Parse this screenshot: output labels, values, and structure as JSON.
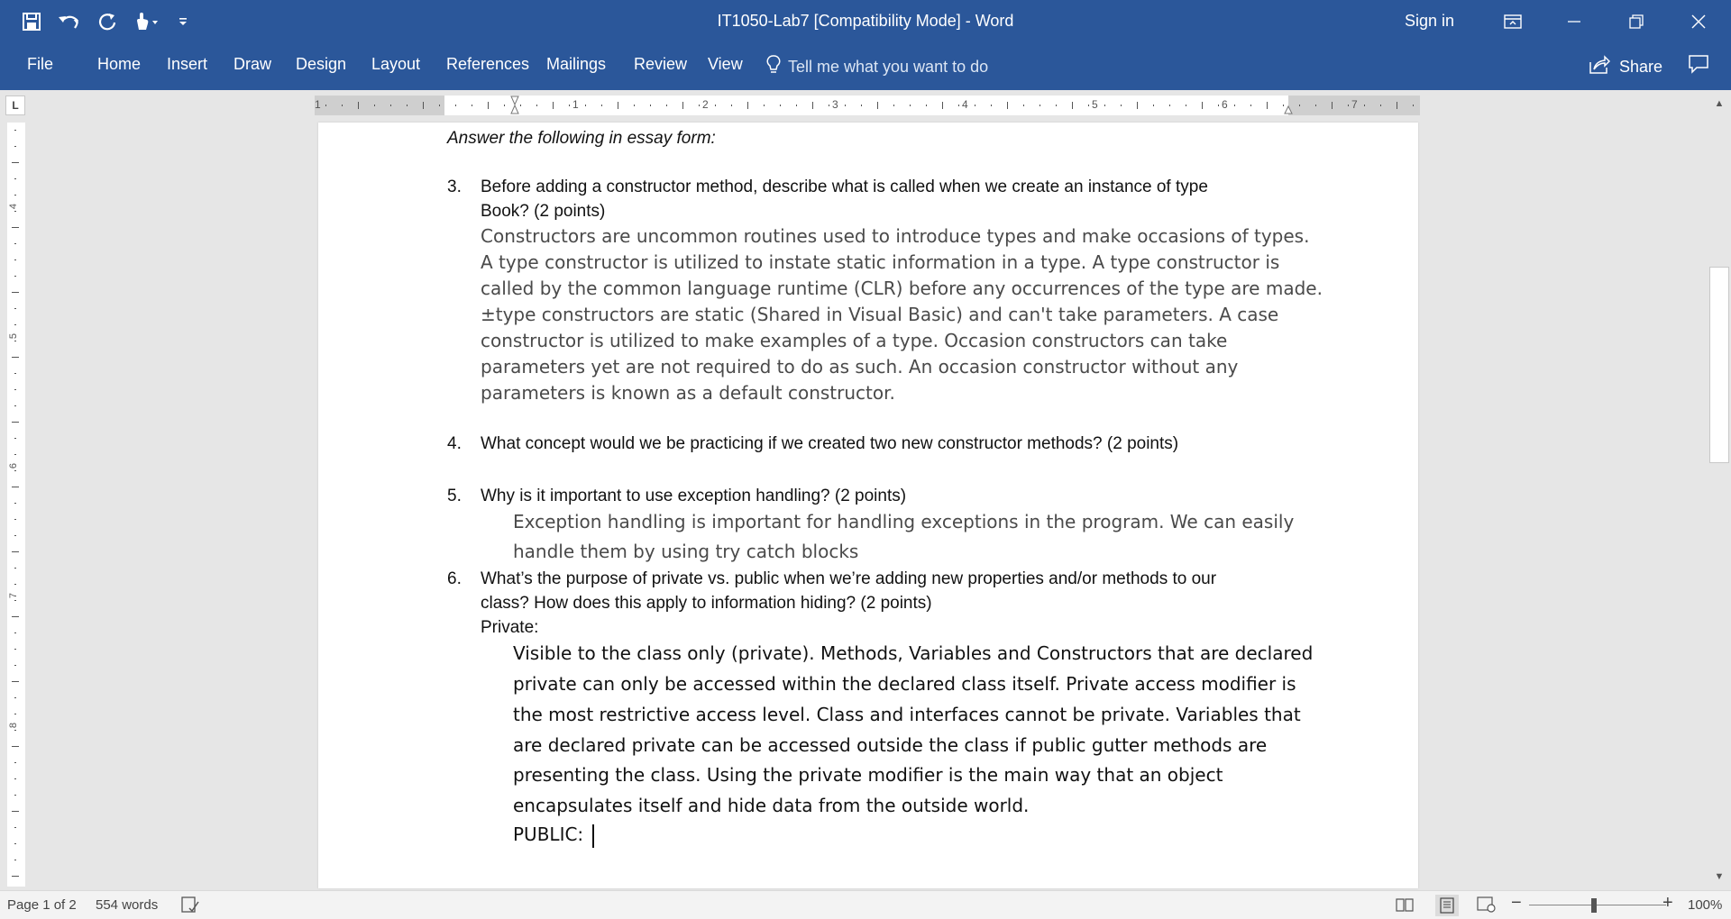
{
  "window": {
    "title": "IT1050-Lab7 [Compatibility Mode]  -  Word",
    "sign_in": "Sign in"
  },
  "qat_icons": [
    "save-icon",
    "undo-icon",
    "redo-icon",
    "touch-mode-icon",
    "customize-qat-icon"
  ],
  "ribbon": {
    "tabs": [
      "File",
      "Home",
      "Insert",
      "Draw",
      "Design",
      "Layout",
      "References",
      "Mailings",
      "Review",
      "View"
    ],
    "tell_me": "Tell me what you want to do",
    "share": "Share"
  },
  "ruler": {
    "numbers": [
      "1",
      "1",
      "2",
      "3",
      "4",
      "5",
      "6",
      "7"
    ],
    "v_numbers": [
      "4",
      "5",
      "6",
      "7",
      "8"
    ]
  },
  "document": {
    "heading": "Answer the following in essay form:",
    "q3": {
      "num": "3.",
      "lines": [
        "Before adding a constructor method, describe what is called when we create an instance of type",
        "Book? (2 points)"
      ],
      "answer": [
        "Constructors are uncommon routines used to introduce types and make occasions of types.",
        "A type constructor is utilized to instate static information in a type. A type constructor is",
        "called by the common language runtime (CLR) before any occurrences of the type are made.",
        "±type constructors are static (Shared in Visual Basic) and can't take parameters. A case",
        "constructor is utilized to make examples of a type. Occasion constructors can take",
        "parameters yet are not required to do as such. An occasion constructor without any",
        "parameters is known as a default constructor."
      ]
    },
    "q4": {
      "num": "4.",
      "lines": [
        "What concept would we be practicing if we created two new constructor methods? (2 points)"
      ]
    },
    "q5": {
      "num": "5.",
      "lines": [
        "Why is it important to use exception handling? (2 points)"
      ],
      "answer": [
        "Exception handling is important for handling exceptions in the program. We can easily",
        "handle them by using try catch blocks"
      ]
    },
    "q6": {
      "num": "6.",
      "lines": [
        "What’s the purpose of private vs. public when we’re adding new properties and/or methods to our",
        "class?  How does this apply to information hiding? (2 points)",
        "Private:"
      ],
      "answer": [
        "Visible to the class only (private). Methods, Variables and Constructors that are declared",
        "private can only be accessed within the declared class itself. Private access modifier is",
        "the most restrictive access level. Class and interfaces cannot be private. Variables that",
        "are declared private can be accessed outside the class if public gutter methods are",
        "presenting the class. Using the private modifier is the main way that an object",
        "encapsulates itself and hide data from the outside world."
      ],
      "public_label": "PUBLIC:"
    }
  },
  "status": {
    "page": "Page 1 of 2",
    "words": "554 words",
    "zoom": "100%"
  }
}
